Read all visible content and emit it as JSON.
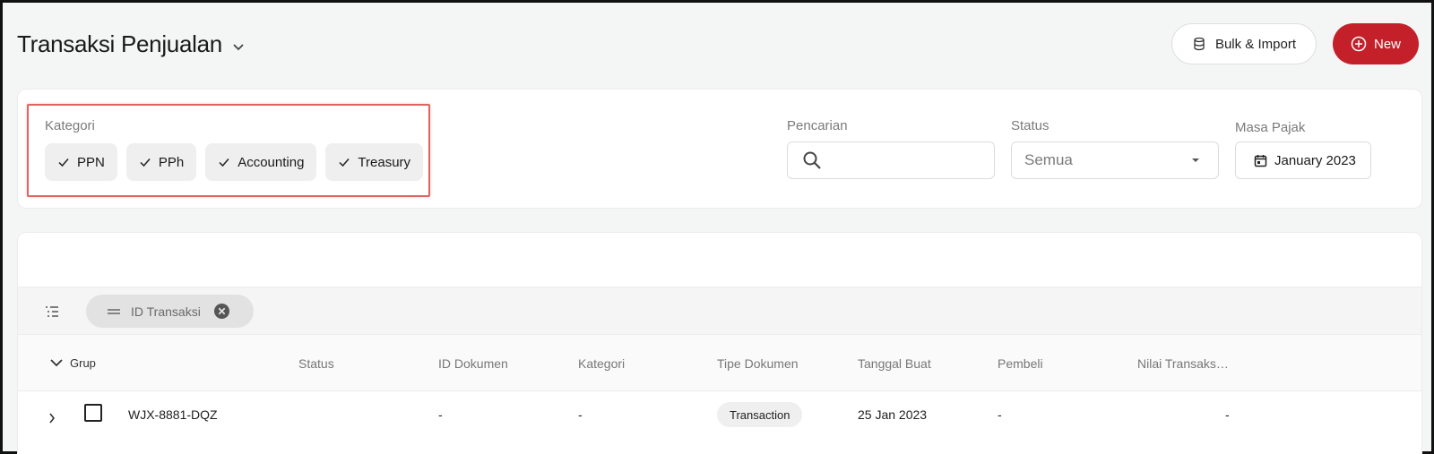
{
  "header": {
    "title": "Transaksi Penjualan",
    "bulk_label": "Bulk & Import",
    "new_label": "New"
  },
  "filters": {
    "kategori_label": "Kategori",
    "chips": [
      "PPN",
      "PPh",
      "Accounting",
      "Treasury"
    ],
    "search_label": "Pencarian",
    "search_value": "",
    "status_label": "Status",
    "status_value": "Semua",
    "masa_label": "Masa Pajak",
    "masa_value": "January 2023"
  },
  "table": {
    "group_chip": "ID Transaksi",
    "columns": {
      "grup": "Grup",
      "status": "Status",
      "id_dokumen": "ID Dokumen",
      "kategori": "Kategori",
      "tipe_dokumen": "Tipe Dokumen",
      "tanggal_buat": "Tanggal Buat",
      "pembeli": "Pembeli",
      "nilai": "Nilai Transaks…"
    },
    "rows": [
      {
        "grup": "WJX-8881-DQZ",
        "id_dokumen": "-",
        "kategori": "-",
        "tipe_dokumen": "Transaction",
        "tanggal_buat": "25 Jan 2023",
        "pembeli": "-",
        "nilai": "-"
      }
    ]
  },
  "colors": {
    "primary": "#c3202a",
    "highlight": "#e0645f"
  }
}
